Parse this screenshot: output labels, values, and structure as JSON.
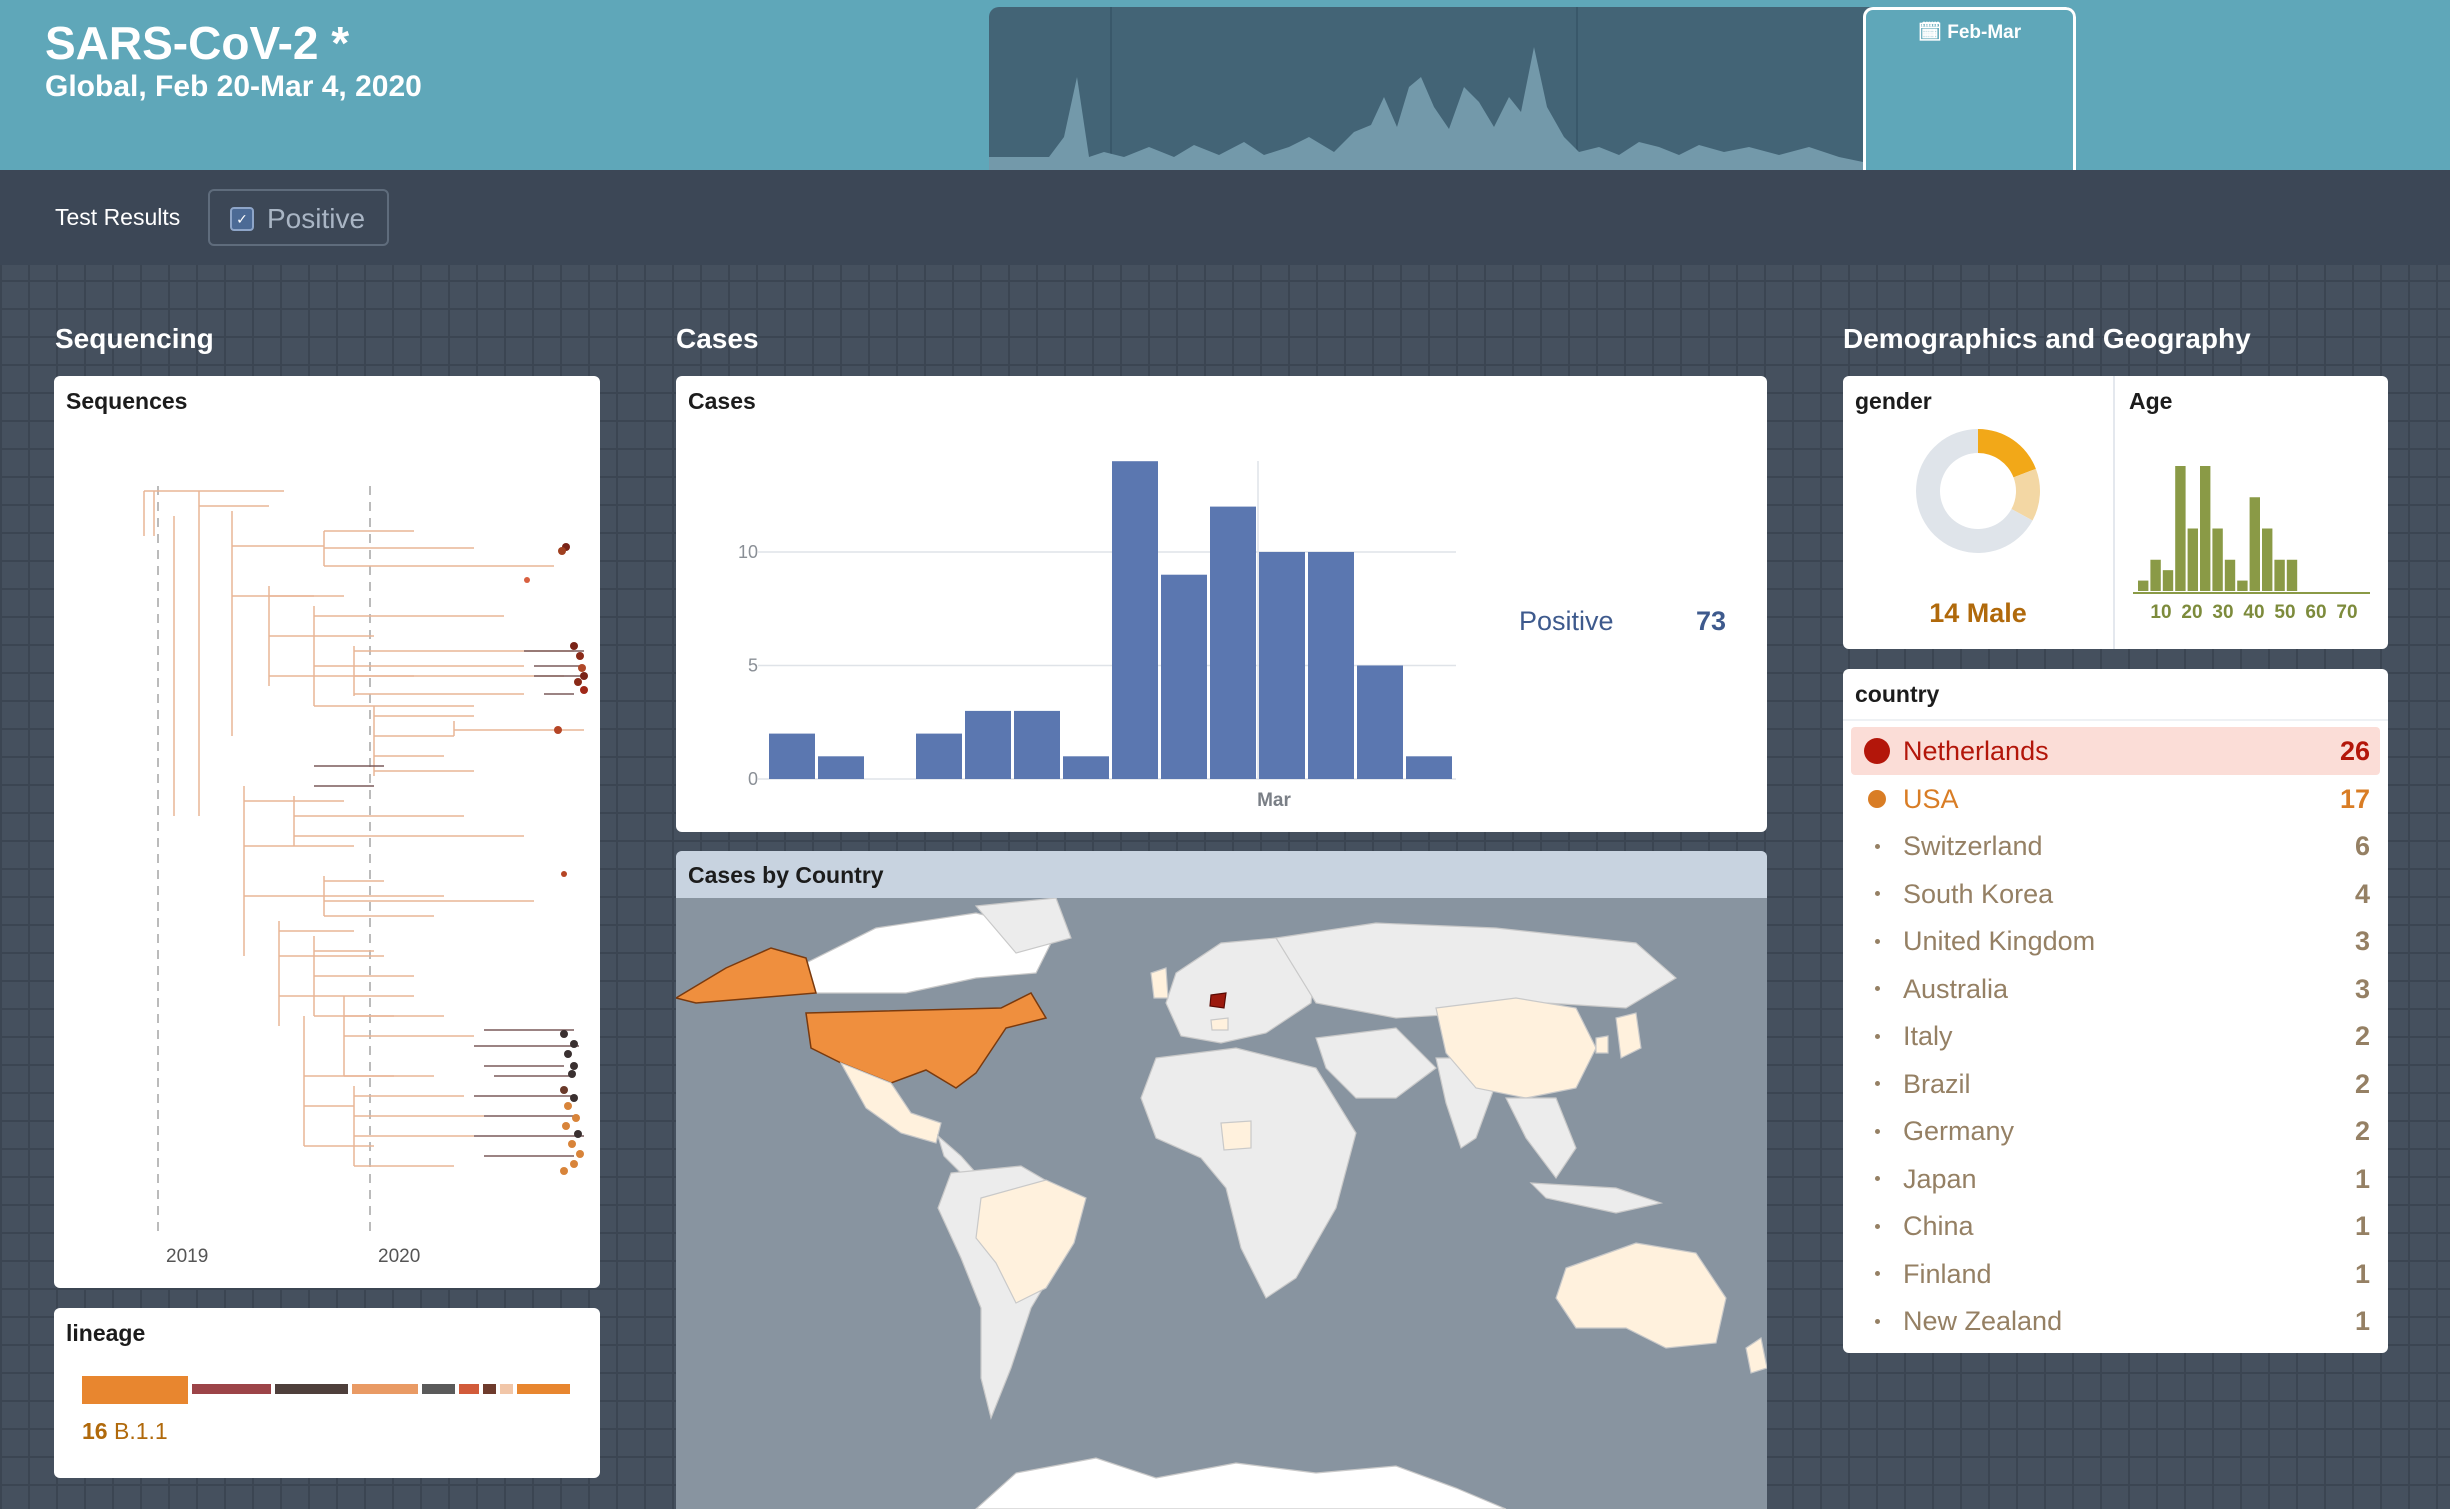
{
  "app": {
    "title": "SARS-CoV-2 *",
    "subtitle": "Global, Feb 20-Mar 4, 2020"
  },
  "timeline": {
    "brush_label": "Feb-Mar",
    "brush_icon": "calendar-icon"
  },
  "filter": {
    "label": "Test Results",
    "chip_label": "Positive",
    "chip_checked": true,
    "check_glyph": "✓"
  },
  "sections": {
    "sequencing": "Sequencing",
    "cases": "Cases",
    "demographics": "Demographics and Geography"
  },
  "sequences_card": {
    "title": "Sequences",
    "axis_ticks": [
      "2019",
      "2020"
    ]
  },
  "lineage_card": {
    "title": "lineage",
    "caption_count": "16",
    "caption_name": "B.1.1",
    "segments": [
      {
        "value": 16,
        "color": "#e8862f"
      },
      {
        "value": 12,
        "color": "#9c4448"
      },
      {
        "value": 11,
        "color": "#4e3f3b"
      },
      {
        "value": 10,
        "color": "#e99a64"
      },
      {
        "value": 5,
        "color": "#5a5a5a"
      },
      {
        "value": 3,
        "color": "#d25b3a"
      },
      {
        "value": 2,
        "color": "#6e3b2c"
      },
      {
        "value": 2,
        "color": "#f1c6a8"
      },
      {
        "value": 8,
        "color": "#e8862f"
      }
    ]
  },
  "cases_card": {
    "title": "Cases",
    "legend_label": "Positive",
    "legend_value": "73",
    "bar_color": "#5b77b0"
  },
  "chart_data": {
    "type": "bar",
    "title": "Cases",
    "xlabel": "",
    "ylabel": "",
    "x_tick_labels": [
      "Mar"
    ],
    "y_ticks": [
      0,
      5,
      10
    ],
    "ylim": [
      0,
      14
    ],
    "grid": true,
    "legend": "right",
    "series": [
      {
        "name": "Positive",
        "values": [
          2,
          1,
          0,
          2,
          3,
          3,
          1,
          14,
          9,
          12,
          10,
          10,
          5,
          1
        ]
      }
    ]
  },
  "map_card": {
    "title": "Cases by Country",
    "ocean_color": "#8894a0",
    "land_color": "#ececec",
    "highlights": {
      "Netherlands": "#9c1a0e",
      "USA": "#ef8f3e",
      "low": "#fff1dd"
    }
  },
  "gender_card": {
    "title": "gender",
    "caption": "14 Male",
    "slices": [
      {
        "value": 14,
        "color": "#f2a818"
      },
      {
        "value": 10,
        "color": "#f3d7a4"
      },
      {
        "value": 49,
        "color": "#dfe4ea"
      }
    ]
  },
  "age_card": {
    "title": "Age",
    "bar_color": "#8a9a46",
    "ticks": [
      "10",
      "20",
      "30",
      "40",
      "50",
      "60",
      "70"
    ],
    "bins": [
      1,
      3,
      2,
      12,
      6,
      12,
      6,
      3,
      1,
      9,
      6,
      3,
      3
    ]
  },
  "country_card": {
    "title": "country",
    "rows": [
      {
        "name": "Netherlands",
        "count": "26",
        "color": "#b3160a",
        "level": "high"
      },
      {
        "name": "USA",
        "count": "17",
        "color": "#d97d25",
        "level": "mid"
      },
      {
        "name": "Switzerland",
        "count": "6",
        "color": "#958064",
        "level": "low"
      },
      {
        "name": "South Korea",
        "count": "4",
        "color": "#958064",
        "level": "low"
      },
      {
        "name": "United Kingdom",
        "count": "3",
        "color": "#958064",
        "level": "low"
      },
      {
        "name": "Australia",
        "count": "3",
        "color": "#958064",
        "level": "low"
      },
      {
        "name": "Italy",
        "count": "2",
        "color": "#958064",
        "level": "low"
      },
      {
        "name": "Brazil",
        "count": "2",
        "color": "#958064",
        "level": "low"
      },
      {
        "name": "Germany",
        "count": "2",
        "color": "#958064",
        "level": "low"
      },
      {
        "name": "Japan",
        "count": "1",
        "color": "#958064",
        "level": "low"
      },
      {
        "name": "China",
        "count": "1",
        "color": "#958064",
        "level": "low"
      },
      {
        "name": "Finland",
        "count": "1",
        "color": "#958064",
        "level": "low"
      },
      {
        "name": "New Zealand",
        "count": "1",
        "color": "#958064",
        "level": "low"
      }
    ]
  }
}
